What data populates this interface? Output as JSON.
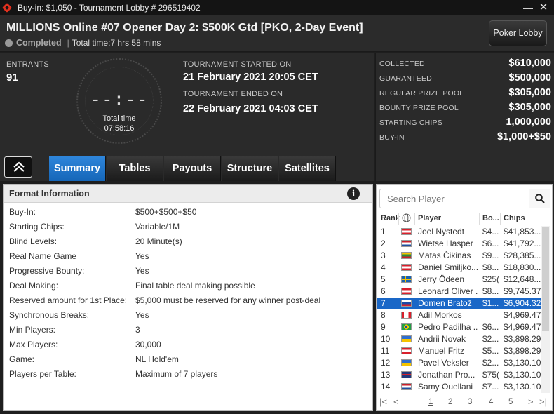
{
  "window": {
    "title": "Buy-in: $1,050 - Tournament Lobby # 296519402"
  },
  "header": {
    "tournament_name": "MILLIONS Online #07 Opener Day 2: $500K Gtd [PKO, 2-Day Event]",
    "status": "Completed",
    "total_time": "Total time:7 hrs  58 mins",
    "lobby_button": "Poker Lobby"
  },
  "info": {
    "entrants_label": "ENTRANTS",
    "entrants_value": "91",
    "clock_digits": "--:--",
    "clock_label": "Total time",
    "clock_time": "07:58:16",
    "started_label": "TOURNAMENT STARTED ON",
    "started_value": "21 February 2021  20:05 CET",
    "ended_label": "TOURNAMENT ENDED ON",
    "ended_value": "22 February 2021  04:03 CET"
  },
  "prize": [
    {
      "label": "COLLECTED",
      "value": "$610,000"
    },
    {
      "label": "GUARANTEED",
      "value": "$500,000"
    },
    {
      "label": "REGULAR PRIZE POOL",
      "value": "$305,000"
    },
    {
      "label": "BOUNTY PRIZE POOL",
      "value": "$305,000"
    },
    {
      "label": "STARTING CHIPS",
      "value": "1,000,000"
    },
    {
      "label": "BUY-IN",
      "value": "$1,000+$50"
    }
  ],
  "tabs": [
    "Summary",
    "Tables",
    "Payouts",
    "Structure",
    "Satellites"
  ],
  "format": {
    "title": "Format Information",
    "info_glyph": "i",
    "rows": [
      {
        "k": "Buy-In:",
        "v": "$500+$500+$50"
      },
      {
        "k": "Starting Chips:",
        "v": "Variable/1M"
      },
      {
        "k": "Blind Levels:",
        "v": "20 Minute(s)"
      },
      {
        "k": "Real Name Game",
        "v": "Yes"
      },
      {
        "k": "Progressive Bounty:",
        "v": "Yes"
      },
      {
        "k": "Deal Making:",
        "v": "Final table deal making possible"
      },
      {
        "k": "Reserved amount for 1st Place:",
        "v": "$5,000 must be reserved for any winner post-deal"
      },
      {
        "k": "Synchronous Breaks:",
        "v": "Yes"
      },
      {
        "k": "Min Players:",
        "v": "3"
      },
      {
        "k": "Max Players:",
        "v": "30,000"
      },
      {
        "k": "Game:",
        "v": "NL Hold'em"
      },
      {
        "k": "Players per Table:",
        "v": "Maximum of 7 players"
      }
    ]
  },
  "players": {
    "search_placeholder": "Search Player",
    "columns": {
      "rank": "Rank",
      "player": "Player",
      "bounty": "Bo...",
      "chips": "Chips"
    },
    "rows": [
      {
        "rank": "1",
        "flag": "austria",
        "name": "Joel Nystedt",
        "bounty": "$4...",
        "chips": "$41,853..."
      },
      {
        "rank": "2",
        "flag": "netherlands",
        "name": "Wietse Hasper",
        "bounty": "$6...",
        "chips": "$41,792..."
      },
      {
        "rank": "3",
        "flag": "lithuania",
        "name": "Matas Čikinas",
        "bounty": "$9...",
        "chips": "$28,385..."
      },
      {
        "rank": "4",
        "flag": "austria",
        "name": "Daniel Smiljko...",
        "bounty": "$8...",
        "chips": "$18,830..."
      },
      {
        "rank": "5",
        "flag": "sweden",
        "name": "Jerry Ödeen",
        "bounty": "$25(",
        "chips": "$12,648..."
      },
      {
        "rank": "6",
        "flag": "austria",
        "name": "Leonard Oliver ...",
        "bounty": "$8...",
        "chips": "$9,745.37"
      },
      {
        "rank": "7",
        "flag": "slovenia",
        "name": "Domen Bratož",
        "bounty": "$1...",
        "chips": "$6,904.32"
      },
      {
        "rank": "8",
        "flag": "canada",
        "name": "Adil Morkos",
        "bounty": "",
        "chips": "$4,969.47"
      },
      {
        "rank": "9",
        "flag": "brazil",
        "name": "Pedro Padilha ...",
        "bounty": "$6...",
        "chips": "$4,969.47"
      },
      {
        "rank": "10",
        "flag": "ukraine",
        "name": "Andrii Novak",
        "bounty": "$2...",
        "chips": "$3,898.29"
      },
      {
        "rank": "11",
        "flag": "austria",
        "name": "Manuel Fritz",
        "bounty": "$5...",
        "chips": "$3,898.29"
      },
      {
        "rank": "12",
        "flag": "ukraine",
        "name": "Pavel Veksler",
        "bounty": "$2...",
        "chips": "$3,130.10"
      },
      {
        "rank": "13",
        "flag": "uk",
        "name": "Jonathan Pro...",
        "bounty": "$75(",
        "chips": "$3,130.10"
      },
      {
        "rank": "14",
        "flag": "netherlands",
        "name": "Samy Ouellani",
        "bounty": "$7...",
        "chips": "$3,130.10"
      }
    ],
    "selected_rank": "7",
    "pages": [
      "1",
      "2",
      "3",
      "4",
      "5"
    ]
  },
  "flag_colors": {
    "austria": "#d8202c",
    "netherlands": "#1f4fa0",
    "lithuania": "#2b8a3e",
    "sweden": "#1b63b0",
    "slovenia": "#1d4aa5",
    "canada": "#d8202c",
    "brazil": "#229e45",
    "ukraine": "#2f6fd0",
    "uk": "#243a7a"
  }
}
